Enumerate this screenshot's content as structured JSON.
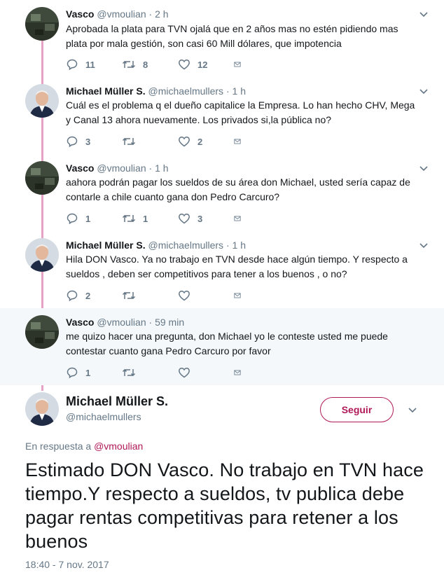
{
  "thread": [
    {
      "name": "Vasco",
      "handle": "@vmoulian",
      "sep": "·",
      "time": "2 h",
      "text": "Aprobada la plata para TVN ojalá que en 2 años mas no estén pidiendo mas plata por mala gestión, son casi 60 Mill dólares, que impotencia",
      "replies": "11",
      "retweets": "8",
      "likes": "12"
    },
    {
      "name": "Michael Müller S.",
      "handle": "@michaelmullers",
      "sep": "·",
      "time": "1 h",
      "text": "Cuál es el problema q el dueño capitalice la Empresa. Lo han hecho CHV, Mega y Canal 13 ahora nuevamente. Los privados si,la pública no?",
      "replies": "3",
      "retweets": "",
      "likes": "2"
    },
    {
      "name": "Vasco",
      "handle": "@vmoulian",
      "sep": "·",
      "time": "1 h",
      "text": "aahora podrán pagar los sueldos de su área don Michael, usted sería capaz de contarle a chile cuanto gana don Pedro Carcuro?",
      "replies": "1",
      "retweets": "1",
      "likes": "3"
    },
    {
      "name": "Michael Müller S.",
      "handle": "@michaelmullers",
      "sep": "·",
      "time": "1 h",
      "text": "Hila DON Vasco. Ya no trabajo en TVN desde hace algún tiempo. Y respecto a sueldos , deben ser competitivos para tener a los buenos , o no?",
      "replies": "2",
      "retweets": "",
      "likes": ""
    },
    {
      "name": "Vasco",
      "handle": "@vmoulian",
      "sep": "·",
      "time": "59 min",
      "text": "me quizo hacer una pregunta, don Michael yo le conteste usted me puede contestar cuanto gana Pedro Carcuro por favor",
      "replies": "1",
      "retweets": "",
      "likes": ""
    }
  ],
  "main": {
    "name": "Michael Müller S.",
    "handle": "@michaelmullers",
    "follow_label": "Seguir",
    "reply_prefix": "En respuesta a",
    "reply_handle": "@vmoulian",
    "text": "Estimado DON Vasco. No trabajo en TVN hace tiempo.Y respecto a sueldos, tv publica debe pagar rentas competitivas para retener a los buenos",
    "timestamp": "18:40 - 7 nov. 2017"
  },
  "icons": {
    "reply": "reply-icon",
    "retweet": "retweet-icon",
    "like": "heart-icon",
    "dm": "envelope-icon",
    "caret": "chevron-down-icon"
  },
  "colors": {
    "accent": "#b01958",
    "thread_line": "#e6a2c4",
    "muted": "#657786",
    "highlight_bg": "#f5f8fa"
  }
}
